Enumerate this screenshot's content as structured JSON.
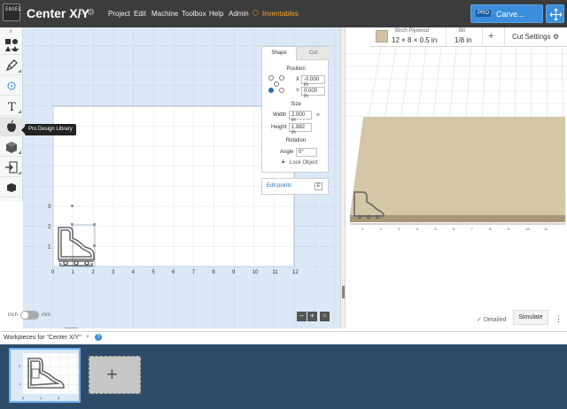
{
  "header": {
    "project_title": "Center X/Y",
    "star_icon": "star-outline-icon",
    "settings_icon": "gear-icon",
    "menu": [
      "Project",
      "Edit",
      "Machine",
      "Toolbox",
      "Help",
      "Admin"
    ],
    "inventables_label": "Inventables",
    "carve_badge": "PRO",
    "carve_label": "Carve..."
  },
  "tools": {
    "tooltip": "Pro Design Library",
    "items": [
      "shapes-icon",
      "pen-icon",
      "target-icon",
      "text-icon",
      "apple-icon",
      "box-icon",
      "import-icon",
      "3d-icon"
    ]
  },
  "shape_panel": {
    "tab_shape": "Shape",
    "tab_cut": "Cut",
    "position_title": "Position",
    "x_label": "X",
    "x_value": "-0.000 in",
    "y_label": "Y",
    "y_value": "0.000 in",
    "size_title": "Size",
    "width_label": "Width",
    "width_value": "2.000 in",
    "height_label": "Height",
    "height_value": "1.982 in",
    "rotation_title": "Rotation",
    "angle_label": "Angle",
    "angle_value": "0°",
    "lock_label": "Lock Object"
  },
  "edit_points": {
    "label": "Edit points",
    "key": "E"
  },
  "canvas": {
    "x_ticks": [
      "0",
      "1",
      "2",
      "3",
      "4",
      "5",
      "6",
      "7",
      "8",
      "9",
      "10",
      "11",
      "12"
    ],
    "y_ticks": [
      "1",
      "2",
      "3"
    ]
  },
  "units": {
    "left": "inch",
    "right": "mm"
  },
  "zoom": {
    "minus": "−",
    "plus": "+",
    "home": "⌂"
  },
  "preview": {
    "material_name": "Birch Plywood",
    "material_dims": "12 × 8 × 0.5 in",
    "bit_label": "Bit",
    "bit_value": "1/8 in",
    "add_label": "+",
    "cut_settings": "Cut Settings",
    "detailed_label": "Detailed",
    "simulate_label": "Simulate",
    "more_label": "⋮",
    "x_ticks": [
      "1",
      "2",
      "3",
      "4",
      "5",
      "6",
      "7",
      "8",
      "9",
      "10",
      "11"
    ],
    "colors": {
      "wood_top": "#d4c7a8",
      "wood_edge": "#a89777"
    }
  },
  "workpieces": {
    "title": "Workpieces for \"Center X/Y\"",
    "help": "?",
    "thumb_ticks": [
      "0",
      "1",
      "2"
    ],
    "thumb_y": [
      "1",
      "2"
    ],
    "add_label": "+"
  }
}
